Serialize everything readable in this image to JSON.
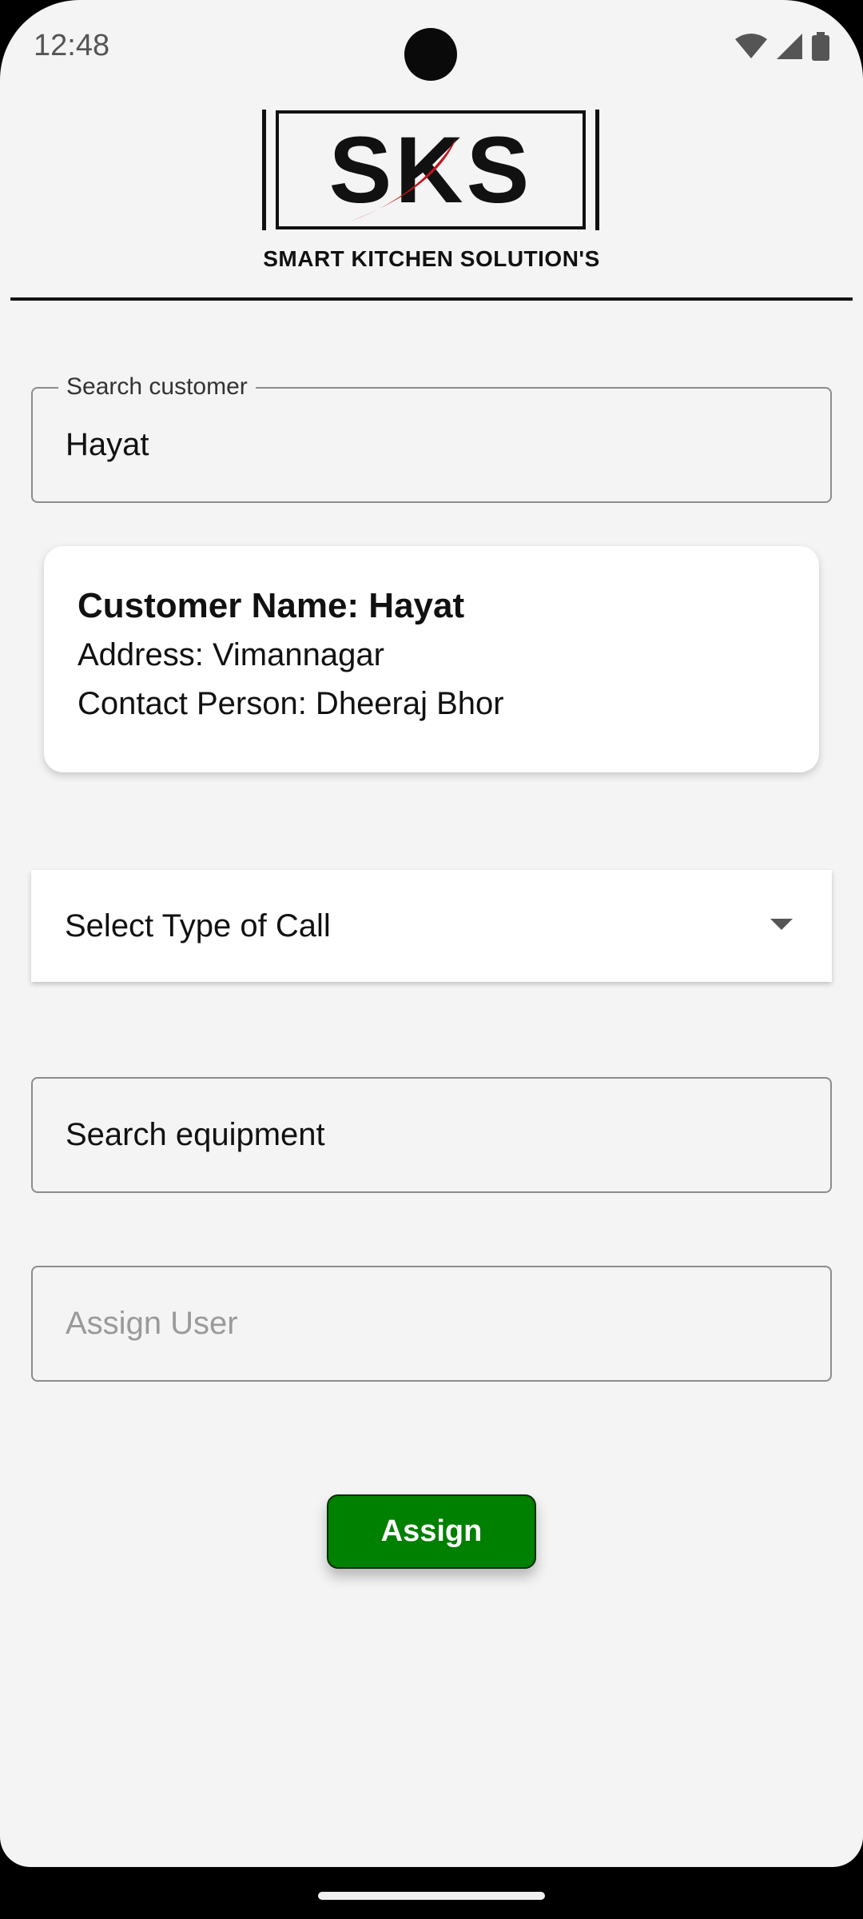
{
  "status_bar": {
    "time": "12:48",
    "icons": [
      "wifi-icon",
      "cellular-signal-icon",
      "battery-icon"
    ]
  },
  "header": {
    "logo_text": "SKS",
    "company_name": "SMART KITCHEN SOLUTION'S"
  },
  "search_customer": {
    "label": "Search customer",
    "value": "Hayat"
  },
  "customer_card": {
    "name_line": "Customer Name: Hayat",
    "address_line": "Address: Vimannagar",
    "contact_line": "Contact Person: Dheeraj Bhor"
  },
  "call_type": {
    "label": "Select Type of Call",
    "icon": "dropdown-arrow-icon"
  },
  "search_equipment": {
    "value": "Search equipment"
  },
  "assign_user": {
    "placeholder": "Assign User"
  },
  "assign_button": {
    "label": "Assign"
  },
  "colors": {
    "background": "#f4f4f4",
    "button": "#008000",
    "logo_red": "#c0141b",
    "text": "#111111"
  }
}
